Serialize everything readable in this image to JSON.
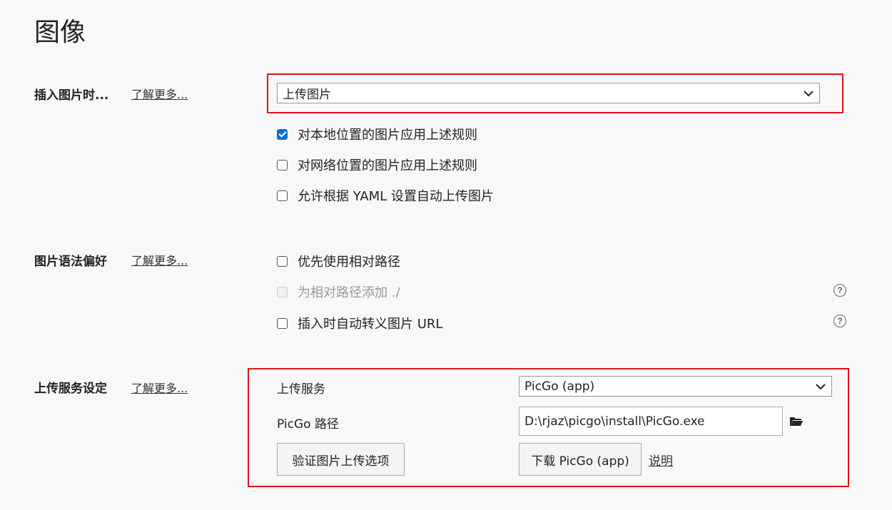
{
  "page": {
    "title": "图像"
  },
  "insert_image": {
    "label": "插入图片时...",
    "learn_more": "了解更多...",
    "action_select": "上传图片",
    "options": [
      {
        "label": "对本地位置的图片应用上述规则",
        "checked": true
      },
      {
        "label": "对网络位置的图片应用上述规则",
        "checked": false
      },
      {
        "label": "允许根据 YAML 设置自动上传图片",
        "checked": false
      }
    ]
  },
  "image_syntax": {
    "label": "图片语法偏好",
    "learn_more": "了解更多...",
    "options": [
      {
        "label": "优先使用相对路径",
        "checked": false,
        "disabled": false
      },
      {
        "label": "为相对路径添加 ./",
        "checked": false,
        "disabled": true
      },
      {
        "label": "插入时自动转义图片 URL",
        "checked": false,
        "disabled": false
      }
    ]
  },
  "upload_service": {
    "label": "上传服务设定",
    "learn_more": "了解更多...",
    "service_label": "上传服务",
    "service_value": "PicGo (app)",
    "path_label": "PicGo 路径",
    "path_value": "D:\\rjaz\\picgo\\install\\PicGo.exe",
    "verify_button": "验证图片上传选项",
    "download_button": "下载 PicGo (app)",
    "explain_link": "说明"
  },
  "colors": {
    "highlight": "#e0121b",
    "checkbox_checked": "#0b6fd3"
  },
  "icons": [
    "chevron-down-icon",
    "help-icon",
    "folder-icon"
  ]
}
